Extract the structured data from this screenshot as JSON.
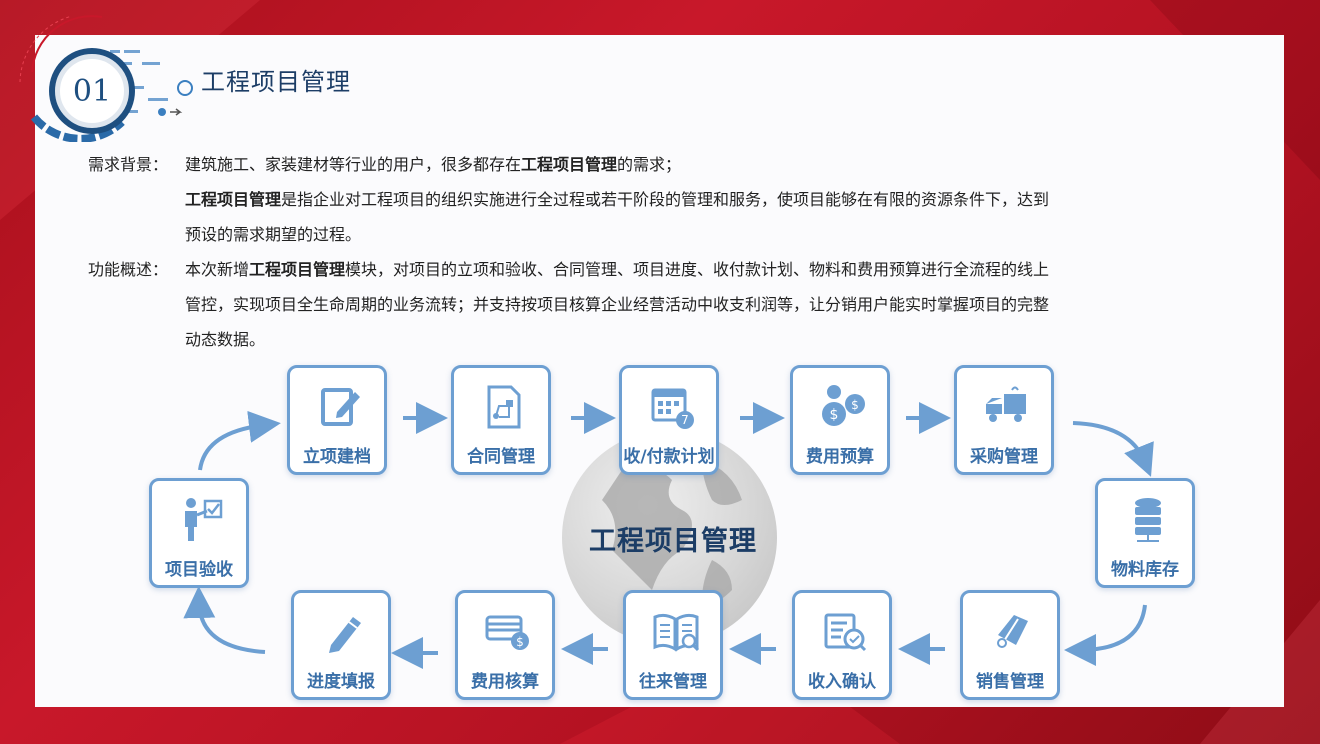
{
  "header": {
    "badge_number": "01",
    "title": "工程项目管理"
  },
  "background": {
    "label": "需求背景：",
    "line1_pre": "建筑施工、家装建材等行业的用户，很多都存在",
    "line1_bold": "工程项目管理",
    "line1_post": "的需求；",
    "line2_bold": "工程项目管理",
    "line2_post": "是指企业对工程项目的组织实施进行全过程或若干阶段的管理和服务，使项目能够在有限的资源条件下，达到",
    "line3": "预设的需求期望的过程。"
  },
  "overview": {
    "label": "功能概述：",
    "line1_pre": "本次新增",
    "line1_bold": "工程项目管理",
    "line1_post": "模块，对项目的立项和验收、合同管理、项目进度、收付款计划、物料和费用预算进行全流程的线上",
    "line2": "管控，实现项目全生命周期的业务流转；并支持按项目核算企业经营活动中收支利润等，让分销用户能实时掌握项目的完整",
    "line3": "动态数据。"
  },
  "diagram": {
    "center_title": "工程项目管理",
    "nodes": {
      "lixiang": "立项建档",
      "hetong": "合同管理",
      "shoufu": "收/付款计划",
      "feiyong_yusuan": "费用预算",
      "caigou": "采购管理",
      "wuliao": "物料库存",
      "xiaoshou": "销售管理",
      "shouru": "收入确认",
      "wanglai": "往来管理",
      "feiyong_hesuan": "费用核算",
      "jindu": "进度填报",
      "yanshou": "项目验收"
    },
    "calendar_day": "7",
    "icons": [
      "edit-document-icon",
      "contract-flow-icon",
      "calendar-icon",
      "dollar-coins-icon",
      "delivery-truck-icon",
      "database-icon",
      "price-tag-icon",
      "invoice-check-icon",
      "open-book-icon",
      "card-money-icon",
      "pencil-icon",
      "presenter-check-icon"
    ],
    "accent_color": "#6d9fd2",
    "label_color": "#3a6fa8"
  }
}
